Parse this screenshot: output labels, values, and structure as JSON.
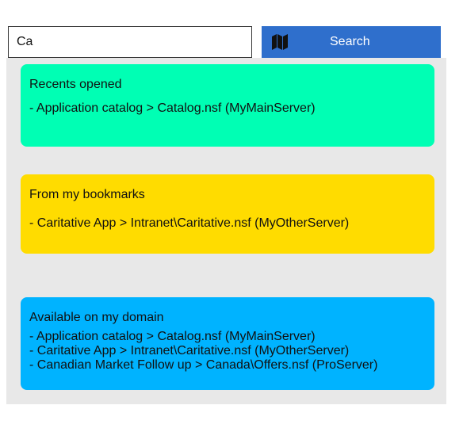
{
  "search": {
    "value": "Ca",
    "button_label": "Search",
    "button_icon": "map-icon",
    "button_color": "#2f6fcc"
  },
  "results": {
    "recents": {
      "title": "Recents opened",
      "color": "#00ffb4",
      "items": [
        "- Application catalog > Catalog.nsf (MyMainServer)"
      ]
    },
    "bookmarks": {
      "title": "From my bookmarks",
      "color": "#ffdc00",
      "items": [
        "- Caritative App > Intranet\\Caritative.nsf (MyOtherServer)"
      ]
    },
    "domain": {
      "title": "Available on my domain",
      "color": "#00b3ff",
      "items": [
        "- Application catalog > Catalog.nsf (MyMainServer)",
        "- Caritative App > Intranet\\Caritative.nsf (MyOtherServer)",
        "- Canadian Market Follow up > Canada\\Offers.nsf (ProServer)"
      ]
    }
  }
}
